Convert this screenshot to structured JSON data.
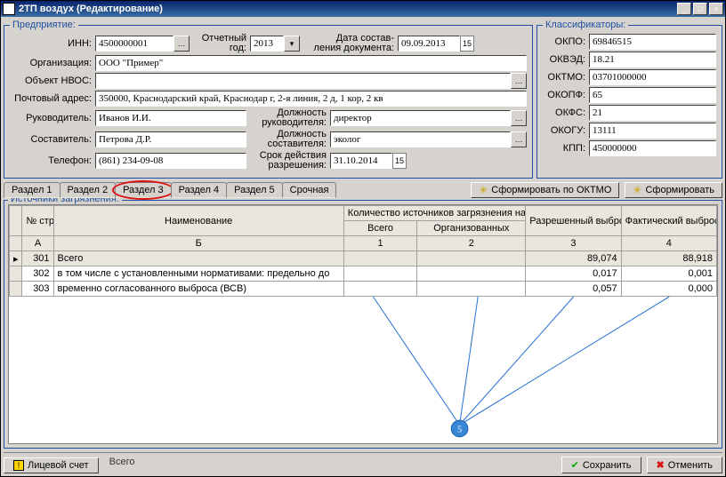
{
  "title": "2ТП воздух (Редактирование)",
  "window_buttons": {
    "min": "_",
    "max": "□",
    "close": "×"
  },
  "company": {
    "legend": "Предприятие:",
    "inn_label": "ИНН:",
    "inn": "4500000001",
    "year_label": "Отчетный год:",
    "year": "2013",
    "docdate_label": "Дата состав-\nления документа:",
    "docdate": "09.09.2013",
    "org_label": "Организация:",
    "org": "ООО \"Пример\"",
    "object_label": "Объект НВОС:",
    "object": "",
    "addr_label": "Почтовый адрес:",
    "addr": "350000, Краснодарский край, Краснодар г, 2-я линия, 2 д, 1 кор, 2 кв",
    "head_label": "Руководитель:",
    "head": "Иванов И.И.",
    "head_pos_label": "Должность руководителя:",
    "head_pos": "директор",
    "author_label": "Составитель:",
    "author": "Петрова Д.Р.",
    "author_pos_label": "Должность составителя:",
    "author_pos": "эколог",
    "phone_label": "Телефон:",
    "phone": "(861) 234-09-08",
    "permit_label": "Срок действия разрешения:",
    "permit": "31.10.2014"
  },
  "classifiers": {
    "legend": "Классификаторы:",
    "okpo_label": "ОКПО:",
    "okpo": "69846515",
    "okved_label": "ОКВЭД:",
    "okved": "18.21",
    "oktmo_label": "ОКТМО:",
    "oktmo": "03701000000",
    "okopf_label": "ОКОПФ:",
    "okopf": "65",
    "okfs_label": "ОКФС:",
    "okfs": "21",
    "okogu_label": "ОКОГУ:",
    "okogu": "13111",
    "kpp_label": "КПП:",
    "kpp": "450000000"
  },
  "tabs": [
    "Раздел 1",
    "Раздел 2",
    "Раздел 3",
    "Раздел 4",
    "Раздел 5",
    "Срочная"
  ],
  "btn_form_oktmo": "Сформировать по ОКТМО",
  "btn_form": "Сформировать",
  "sources": {
    "legend": "Источники загрязнения:",
    "headers": {
      "no": "№ стр.",
      "name": "Наименование",
      "count_group": "Количество источников загрязнения на конец года, единиц",
      "total": "Всего",
      "org": "Организованных",
      "allowed": "Разрешенный выброс веществ, тонн",
      "actual": "Фактический выброс веществ, тонн",
      "A": "А",
      "B": "Б",
      "c1": "1",
      "c2": "2",
      "c3": "3",
      "c4": "4"
    },
    "rows": [
      {
        "no": "301",
        "name": "Всего",
        "c1": "",
        "c2": "",
        "c3": "89,074",
        "c4": "88,918"
      },
      {
        "no": "302",
        "name": "в том числе с установленными нормативами: предельно до",
        "c1": "",
        "c2": "",
        "c3": "0,017",
        "c4": "0,001"
      },
      {
        "no": "303",
        "name": "временно согласованного выброса (ВСВ)",
        "c1": "",
        "c2": "",
        "c3": "0,057",
        "c4": "0,000"
      }
    ]
  },
  "annot_node": "5",
  "status_label": "Всего",
  "buttons": {
    "account": "Лицевой счет",
    "save": "Сохранить",
    "cancel": "Отменить"
  }
}
